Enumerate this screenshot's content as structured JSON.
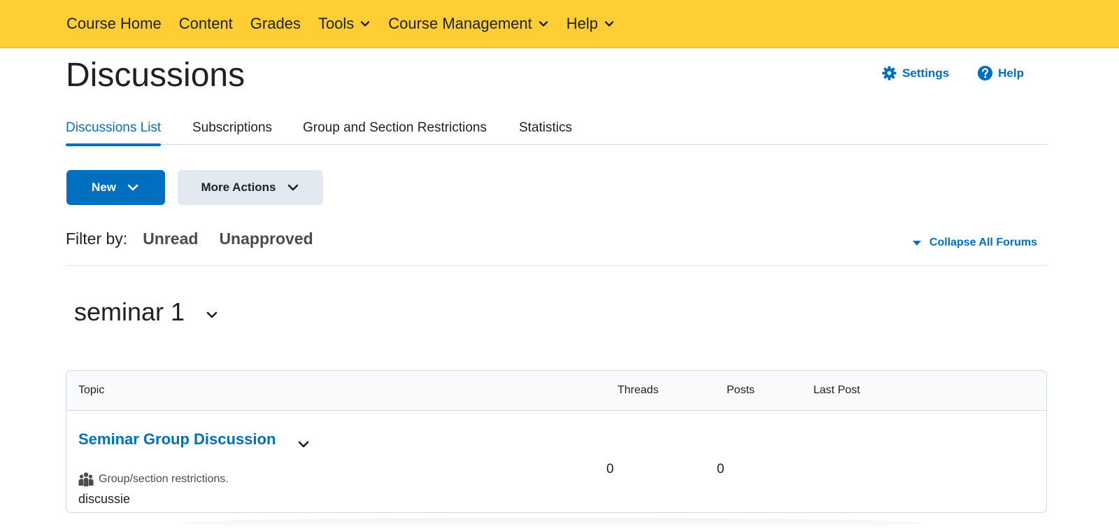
{
  "topnav": {
    "items": [
      {
        "label": "Course Home",
        "has_dropdown": false
      },
      {
        "label": "Content",
        "has_dropdown": false
      },
      {
        "label": "Grades",
        "has_dropdown": false
      },
      {
        "label": "Tools",
        "has_dropdown": true
      },
      {
        "label": "Course Management",
        "has_dropdown": true
      },
      {
        "label": "Help",
        "has_dropdown": true
      }
    ],
    "background": "#ffcd34"
  },
  "page": {
    "title": "Discussions",
    "settings_label": "Settings",
    "help_label": "Help"
  },
  "tabs": [
    {
      "label": "Discussions List",
      "active": true
    },
    {
      "label": "Subscriptions",
      "active": false
    },
    {
      "label": "Group and Section Restrictions",
      "active": false
    },
    {
      "label": "Statistics",
      "active": false
    }
  ],
  "toolbar": {
    "new_label": "New",
    "more_actions_label": "More Actions"
  },
  "filter": {
    "label": "Filter by:",
    "unread_label": "Unread",
    "unapproved_label": "Unapproved",
    "collapse_all_label": "Collapse All Forums"
  },
  "forum": {
    "title": "seminar 1",
    "table": {
      "headers": {
        "topic": "Topic",
        "threads": "Threads",
        "posts": "Posts",
        "last_post": "Last Post"
      },
      "rows": [
        {
          "topic": "Seminar Group Discussion",
          "restriction": "Group/section restrictions.",
          "description": "discussie",
          "threads": "0",
          "posts": "0",
          "last_post": ""
        }
      ]
    }
  },
  "colors": {
    "accent": "#006fbf",
    "nav_bg": "#ffcd34",
    "secondary_button": "#e3e9f1"
  },
  "icons": {
    "nav_dropdown": "chevron-down-icon",
    "settings": "gear-icon",
    "help": "question-circle-icon",
    "collapse": "caret-down-icon",
    "restriction": "group-icon"
  }
}
